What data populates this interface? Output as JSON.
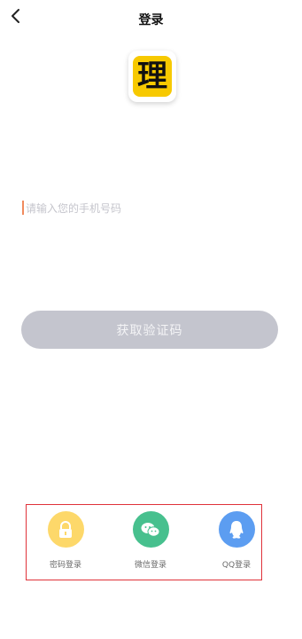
{
  "header": {
    "title": "登录",
    "back_icon": "chevron-left-icon"
  },
  "logo": {
    "glyph": "理",
    "color": "#f7c900"
  },
  "phone": {
    "placeholder": "请输入您的手机号码",
    "value": ""
  },
  "get_code_button": {
    "label": "获取验证码",
    "color": "#c4c5ce"
  },
  "login_options": [
    {
      "label": "密码登录",
      "icon": "lock-icon",
      "color": "#fdd86a"
    },
    {
      "label": "微信登录",
      "icon": "wechat-icon",
      "color": "#47c08e"
    },
    {
      "label": "QQ登录",
      "icon": "qq-icon",
      "color": "#5c9df1"
    }
  ],
  "accent": {
    "highlight_border": "#e0323a",
    "cursor": "#f08a5d"
  }
}
